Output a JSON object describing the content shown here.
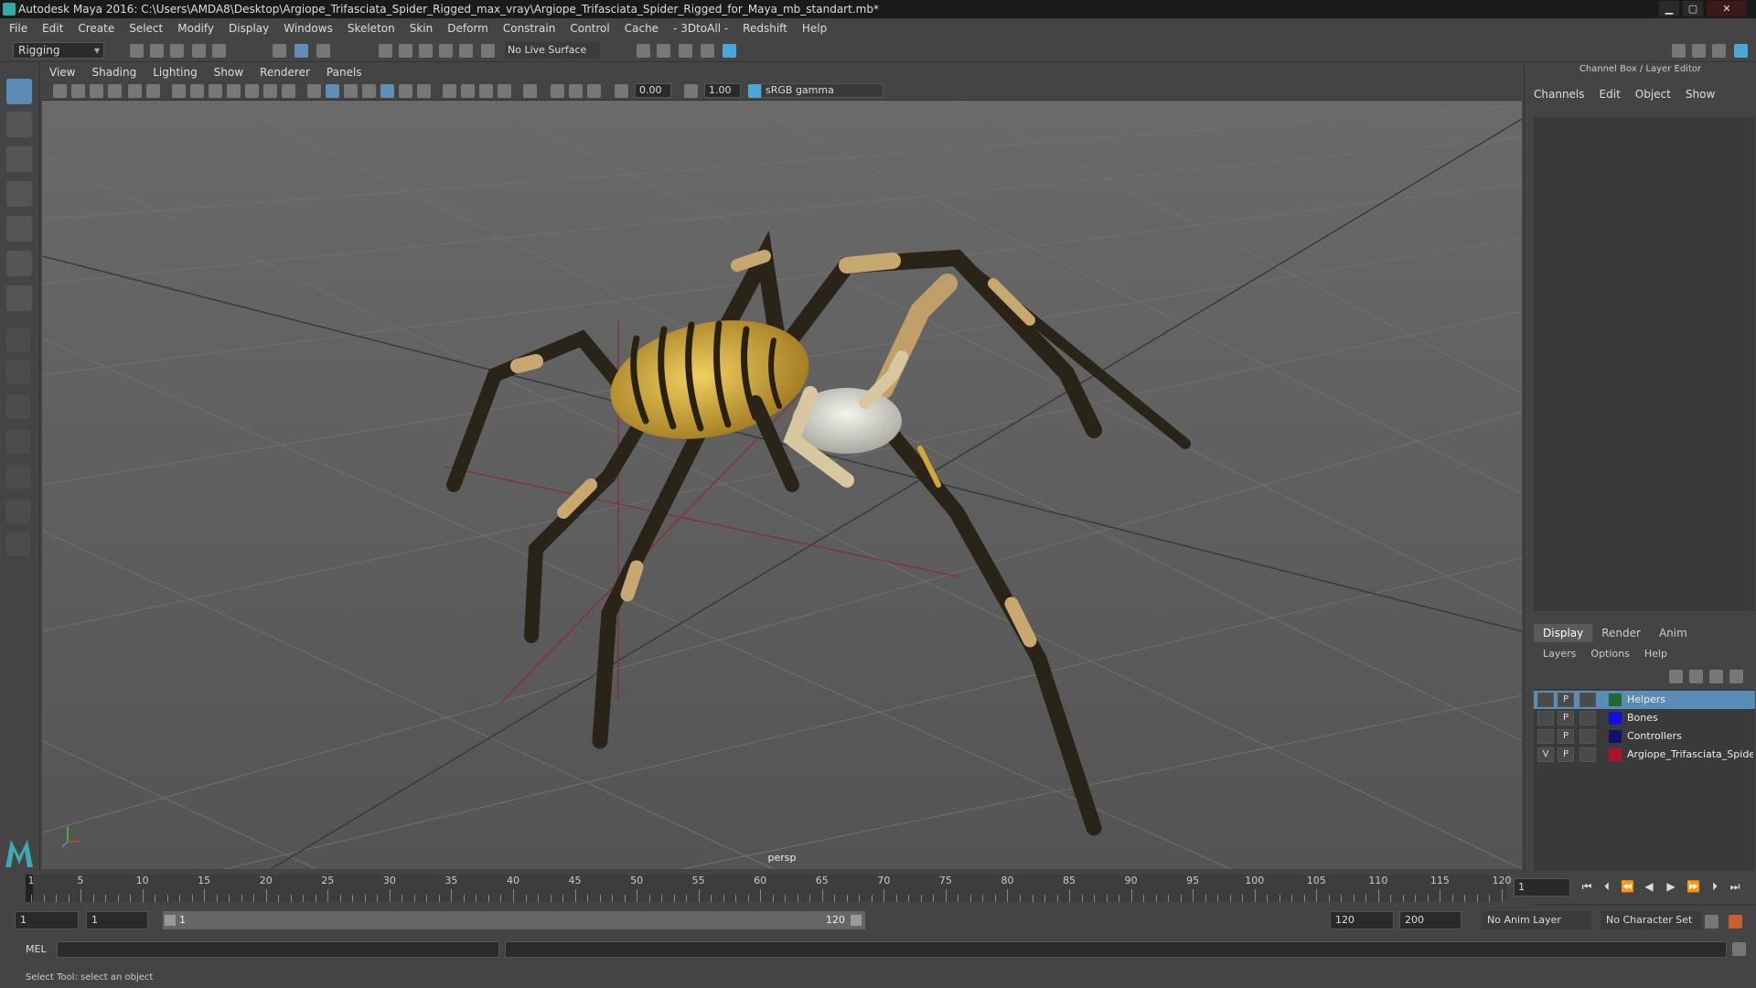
{
  "window": {
    "title": "Autodesk Maya 2016: C:\\Users\\AMDA8\\Desktop\\Argiope_Trifasciata_Spider_Rigged_max_vray\\Argiope_Trifasciata_Spider_Rigged_for_Maya_mb_standart.mb*",
    "minimize": "▁",
    "maximize": "▢",
    "close": "✕"
  },
  "menu": [
    "File",
    "Edit",
    "Create",
    "Select",
    "Modify",
    "Display",
    "Windows",
    "Skeleton",
    "Skin",
    "Deform",
    "Constrain",
    "Control",
    "Cache",
    "- 3DtoAll -",
    "Redshift",
    "Help"
  ],
  "shelf": {
    "mode": "Rigging",
    "live_surface": "No Live Surface"
  },
  "viewport": {
    "menu": [
      "View",
      "Shading",
      "Lighting",
      "Show",
      "Renderer",
      "Panels"
    ],
    "exposure": "0.00",
    "gamma": "1.00",
    "color_space": "sRGB gamma",
    "camera": "persp"
  },
  "right_panel": {
    "title": "Channel Box / Layer Editor",
    "menu": [
      "Channels",
      "Edit",
      "Object",
      "Show"
    ],
    "tabs": [
      "Display",
      "Render",
      "Anim"
    ],
    "active_tab": "Display",
    "submenu": [
      "Layers",
      "Options",
      "Help"
    ],
    "layers": [
      {
        "v": "",
        "p": "P",
        "color": "#1e6b32",
        "name": "Helpers",
        "selected": true
      },
      {
        "v": "",
        "p": "P",
        "color": "#1010e0",
        "name": "Bones",
        "selected": false
      },
      {
        "v": "",
        "p": "P",
        "color": "#101070",
        "name": "Controllers",
        "selected": false
      },
      {
        "v": "V",
        "p": "P",
        "color": "#b01030",
        "name": "Argiope_Trifasciata_Spider_R",
        "selected": false
      }
    ]
  },
  "timeline": {
    "ticks": [
      "1",
      "5",
      "10",
      "15",
      "20",
      "25",
      "30",
      "35",
      "40",
      "45",
      "50",
      "55",
      "60",
      "65",
      "70",
      "75",
      "80",
      "85",
      "90",
      "95",
      "100",
      "105",
      "110",
      "115",
      "120"
    ],
    "current_frame": "1",
    "range_start": "1",
    "range_start2": "1",
    "range_bar_start": "1",
    "range_bar_end": "120",
    "anim_end": "120",
    "max_end": "200",
    "anim_layer": "No Anim Layer",
    "character_set": "No Character Set"
  },
  "cmdline": {
    "label": "MEL"
  },
  "helpline": {
    "text": "Select Tool: select an object"
  }
}
